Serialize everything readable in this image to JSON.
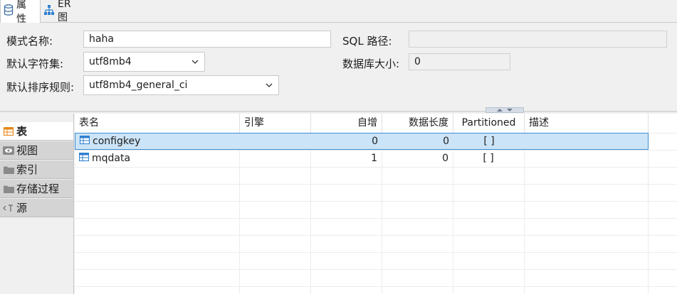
{
  "tabs": [
    {
      "label": "属性",
      "icon": "database-icon",
      "active": true
    },
    {
      "label": "ER 图",
      "icon": "er-diagram-icon",
      "active": false
    }
  ],
  "form": {
    "schema_name_label": "模式名称:",
    "schema_name_value": "haha",
    "sql_path_label": "SQL 路径:",
    "sql_path_value": "",
    "charset_label": "默认字符集:",
    "charset_value": "utf8mb4",
    "db_size_label": "数据库大小:",
    "db_size_value": "0",
    "collation_label": "默认排序规则:",
    "collation_value": "utf8mb4_general_ci"
  },
  "sidenav": [
    {
      "label": "表",
      "icon": "table-icon",
      "active": true
    },
    {
      "label": "视图",
      "icon": "eye-icon",
      "active": false
    },
    {
      "label": "索引",
      "icon": "folder-icon",
      "active": false
    },
    {
      "label": "存储过程",
      "icon": "folder-icon",
      "active": false
    },
    {
      "label": "源",
      "icon": "source-icon",
      "active": false
    }
  ],
  "table": {
    "columns": [
      "表名",
      "引擎",
      "自增",
      "数据长度",
      "Partitioned",
      "描述"
    ],
    "rows": [
      {
        "name": "configkey",
        "engine": "",
        "auto_increment": "0",
        "data_length": "0",
        "partitioned": "[ ]",
        "description": "",
        "selected": true
      },
      {
        "name": "mqdata",
        "engine": "",
        "auto_increment": "1",
        "data_length": "0",
        "partitioned": "[ ]",
        "description": "",
        "selected": false
      }
    ]
  },
  "colors": {
    "accent": "#3c8fd4",
    "selection": "#cce4f7",
    "orange_icon": "#e8891b"
  }
}
